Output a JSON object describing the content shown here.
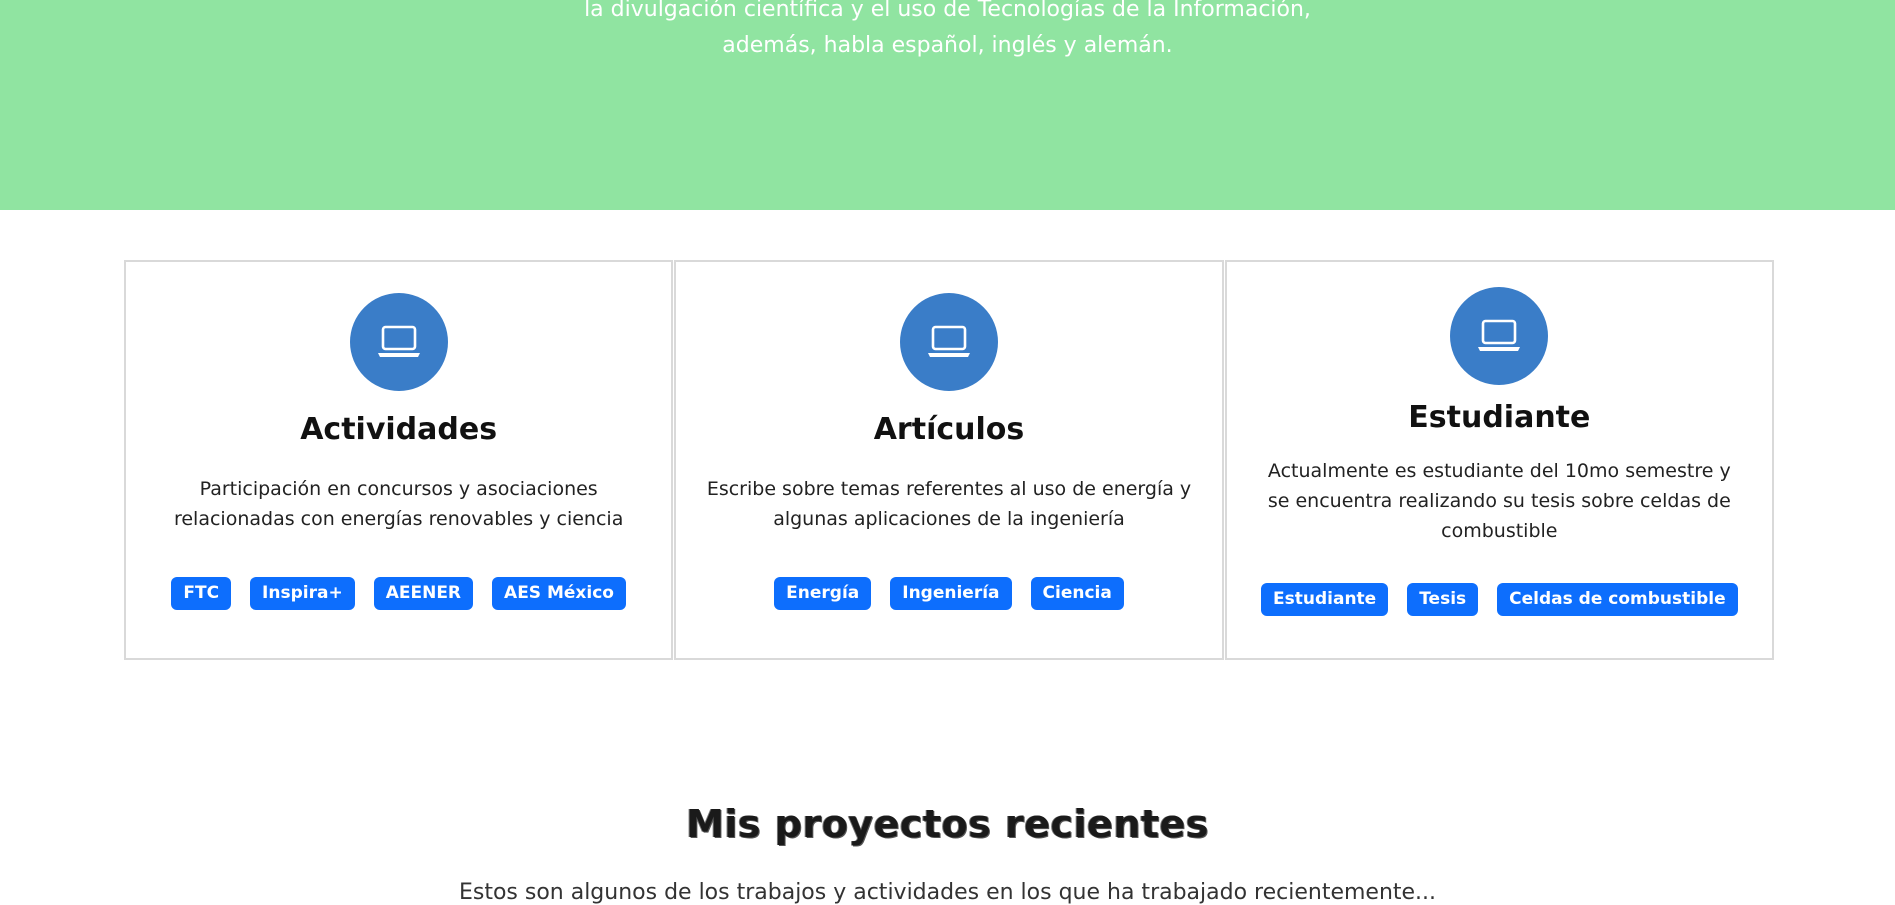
{
  "hero": {
    "line1": "la divulgación científica y el uso de Tecnologías de la Información,",
    "line2": "además, habla español, inglés y alemán."
  },
  "cards": [
    {
      "icon": "laptop-icon",
      "title": "Actividades",
      "description": "Participación en concursos y asociaciones relacionadas con energías renovables y ciencia",
      "tags": [
        "FTC",
        "Inspira+",
        "AEENER",
        "AES México"
      ]
    },
    {
      "icon": "laptop-icon",
      "title": "Artículos",
      "description": "Escribe sobre temas referentes al uso de energía y algunas aplicaciones de la ingeniería",
      "tags": [
        "Energía",
        "Ingeniería",
        "Ciencia"
      ]
    },
    {
      "icon": "laptop-icon",
      "title": "Estudiante",
      "description": "Actualmente es estudiante del 10mo semestre y se encuentra realizando su tesis sobre celdas de combustible",
      "tags": [
        "Estudiante",
        "Tesis",
        "Celdas de combustible"
      ]
    }
  ],
  "projects": {
    "title": "Mis proyectos recientes",
    "subtitle": "Estos son algunos de los trabajos y actividades en los que ha trabajado recientemente..."
  },
  "colors": {
    "hero_bg": "#90e4a1",
    "icon_circle": "#3a7dc8",
    "tag_bg": "#0d6efd"
  }
}
